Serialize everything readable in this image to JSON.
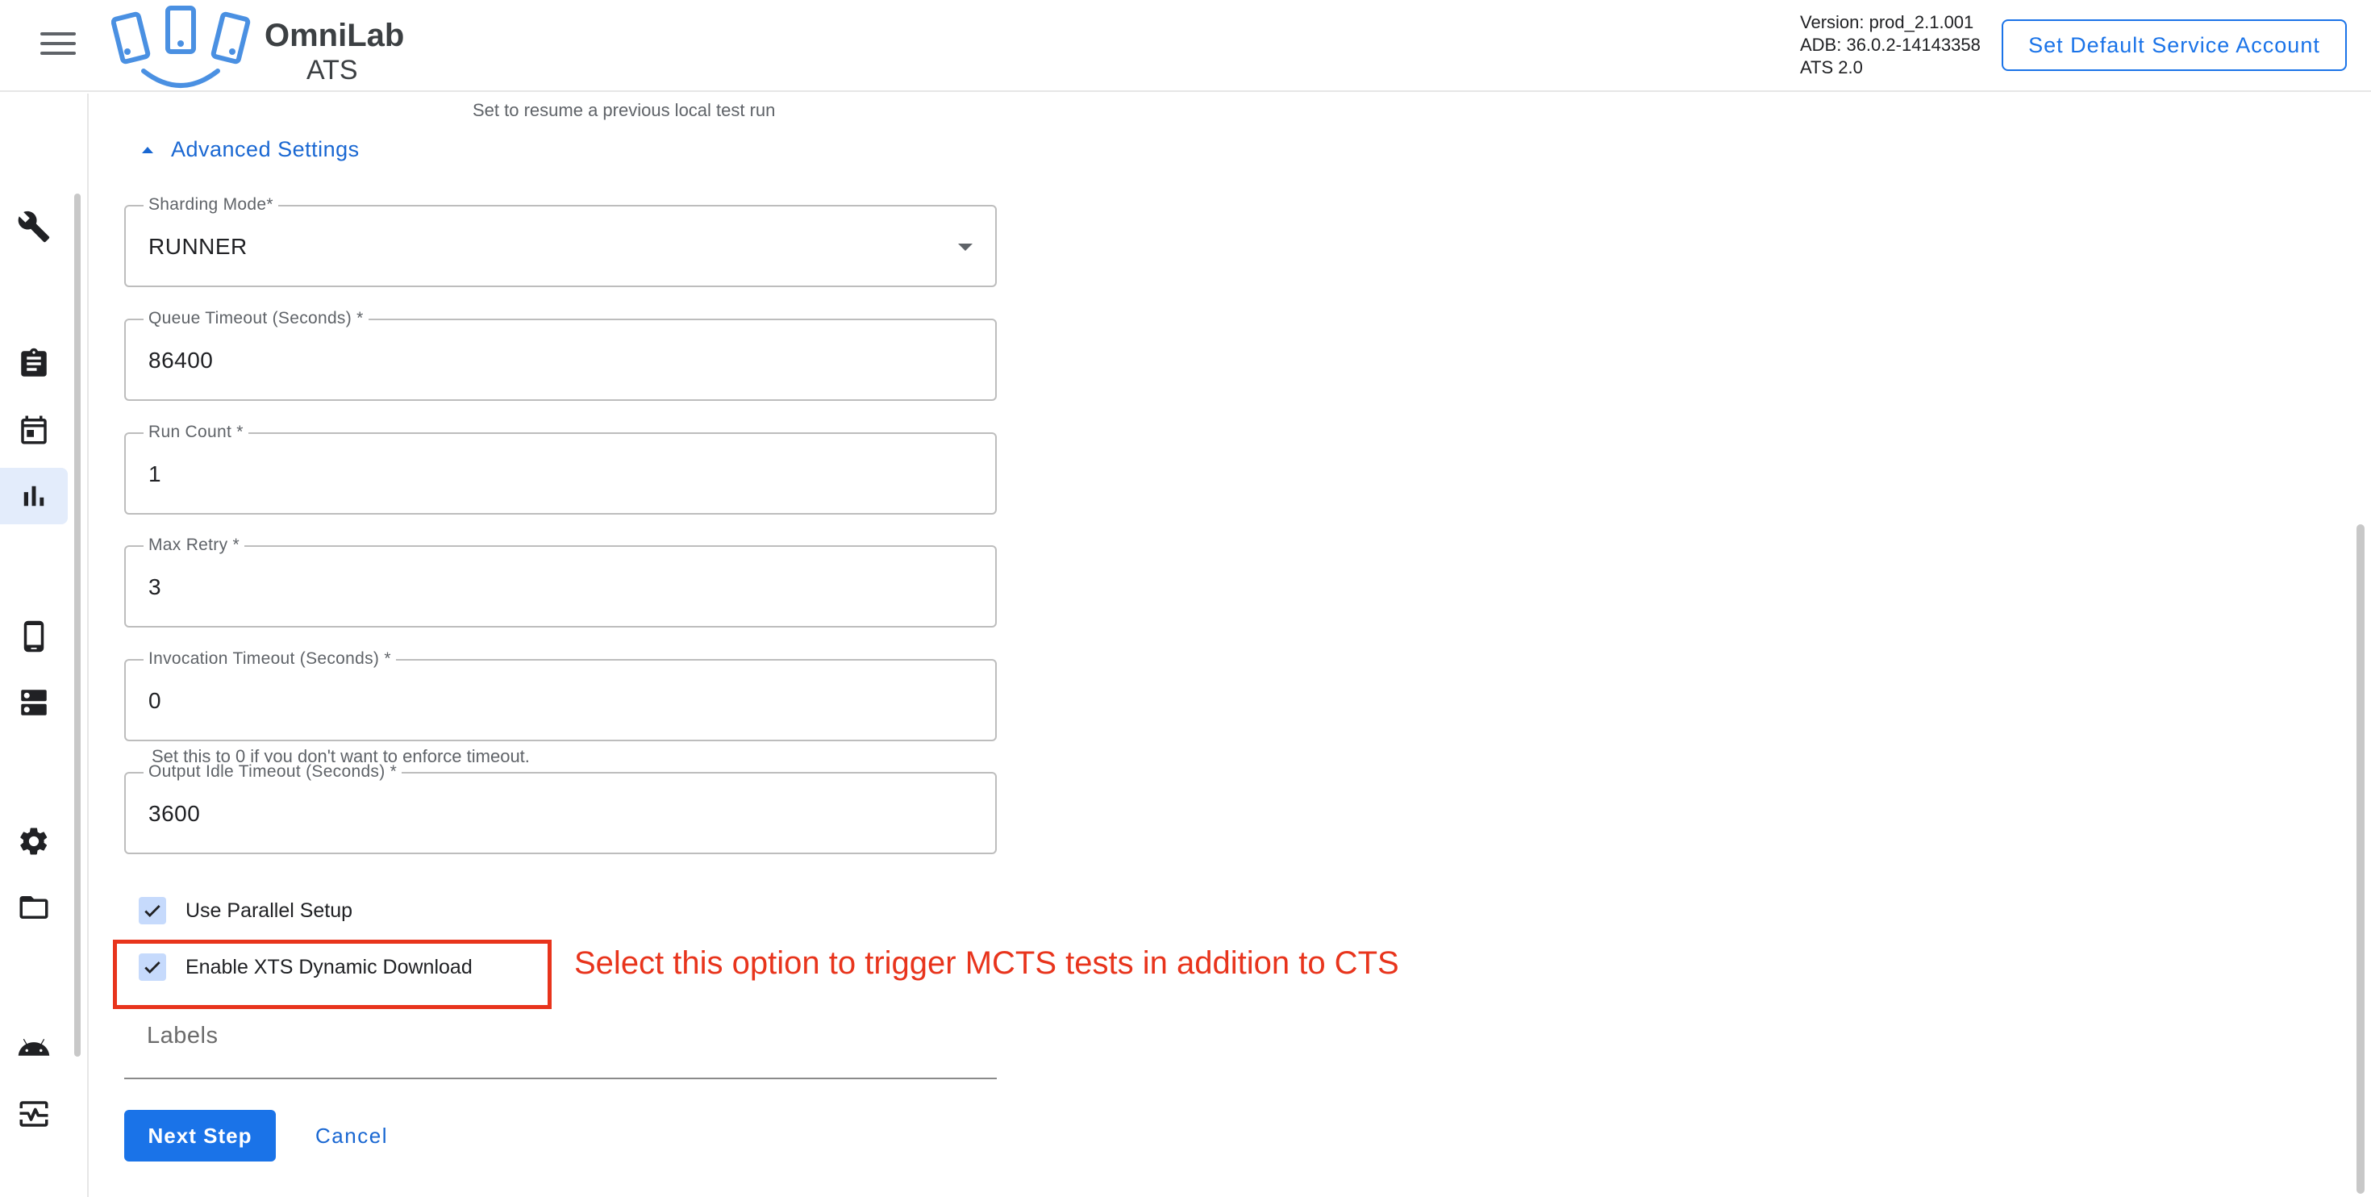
{
  "header": {
    "brand_title": "OmniLab",
    "brand_sub": "ATS",
    "version_lines": [
      "Version: prod_2.1.001",
      "ADB: 36.0.2-14143358",
      "ATS 2.0"
    ],
    "service_account_button": "Set Default Service Account"
  },
  "nav": {
    "items": [
      {
        "icon": "wrench-icon",
        "active": false
      },
      {
        "icon": "clipboard-icon",
        "active": false
      },
      {
        "icon": "calendar-icon",
        "active": false
      },
      {
        "icon": "bar-chart-icon",
        "active": true
      },
      {
        "icon": "phone-icon",
        "active": false
      },
      {
        "icon": "server-icon",
        "active": false
      },
      {
        "icon": "gear-icon",
        "active": false
      },
      {
        "icon": "folder-icon",
        "active": false
      },
      {
        "icon": "android-icon",
        "active": false
      },
      {
        "icon": "monitor-heart-icon",
        "active": false
      }
    ]
  },
  "form": {
    "resume_hint": "Set to resume a previous local test run",
    "advanced_toggle": "Advanced Settings",
    "fields": {
      "sharding_mode": {
        "label": "Sharding Mode*",
        "value": "RUNNER"
      },
      "queue_timeout": {
        "label": "Queue Timeout (Seconds) *",
        "value": "86400"
      },
      "run_count": {
        "label": "Run Count *",
        "value": "1"
      },
      "max_retry": {
        "label": "Max Retry *",
        "value": "3"
      },
      "invocation_timeout": {
        "label": "Invocation Timeout (Seconds) *",
        "value": "0",
        "hint": "Set this to 0 if you don't want to enforce timeout."
      },
      "output_idle_timeout": {
        "label": "Output Idle Timeout (Seconds) *",
        "value": "3600"
      }
    },
    "checkboxes": {
      "parallel_setup": {
        "label": "Use Parallel Setup",
        "checked": true
      },
      "xts_dynamic_download": {
        "label": "Enable XTS Dynamic Download",
        "checked": true
      }
    },
    "labels_placeholder": "Labels",
    "next_button": "Next Step",
    "cancel_button": "Cancel"
  },
  "annotation": {
    "text": "Select this option to trigger MCTS tests in addition to CTS",
    "color": "#e8341c"
  },
  "colors": {
    "accent": "#1a73e8",
    "checkbox_bg": "#c6dafc",
    "nav_active_bg": "#e3ecfb"
  }
}
